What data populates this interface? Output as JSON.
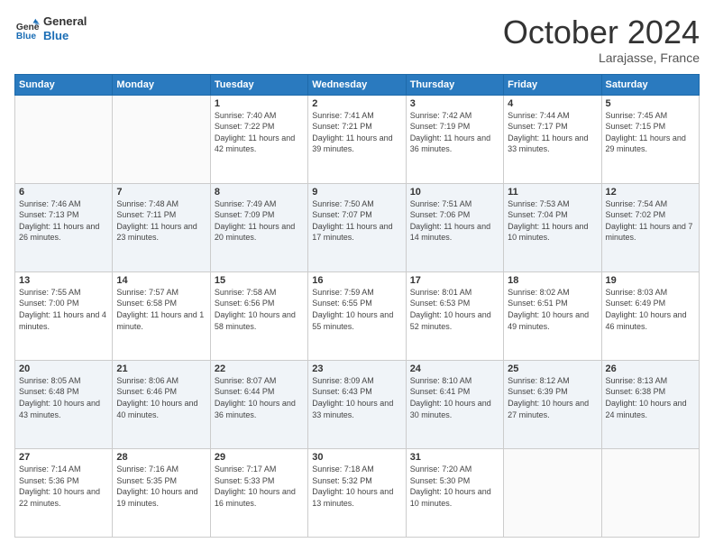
{
  "header": {
    "logo_line1": "General",
    "logo_line2": "Blue",
    "month": "October 2024",
    "location": "Larajasse, France"
  },
  "weekdays": [
    "Sunday",
    "Monday",
    "Tuesday",
    "Wednesday",
    "Thursday",
    "Friday",
    "Saturday"
  ],
  "weeks": [
    [
      {
        "day": "",
        "info": ""
      },
      {
        "day": "",
        "info": ""
      },
      {
        "day": "1",
        "info": "Sunrise: 7:40 AM\nSunset: 7:22 PM\nDaylight: 11 hours and 42 minutes."
      },
      {
        "day": "2",
        "info": "Sunrise: 7:41 AM\nSunset: 7:21 PM\nDaylight: 11 hours and 39 minutes."
      },
      {
        "day": "3",
        "info": "Sunrise: 7:42 AM\nSunset: 7:19 PM\nDaylight: 11 hours and 36 minutes."
      },
      {
        "day": "4",
        "info": "Sunrise: 7:44 AM\nSunset: 7:17 PM\nDaylight: 11 hours and 33 minutes."
      },
      {
        "day": "5",
        "info": "Sunrise: 7:45 AM\nSunset: 7:15 PM\nDaylight: 11 hours and 29 minutes."
      }
    ],
    [
      {
        "day": "6",
        "info": "Sunrise: 7:46 AM\nSunset: 7:13 PM\nDaylight: 11 hours and 26 minutes."
      },
      {
        "day": "7",
        "info": "Sunrise: 7:48 AM\nSunset: 7:11 PM\nDaylight: 11 hours and 23 minutes."
      },
      {
        "day": "8",
        "info": "Sunrise: 7:49 AM\nSunset: 7:09 PM\nDaylight: 11 hours and 20 minutes."
      },
      {
        "day": "9",
        "info": "Sunrise: 7:50 AM\nSunset: 7:07 PM\nDaylight: 11 hours and 17 minutes."
      },
      {
        "day": "10",
        "info": "Sunrise: 7:51 AM\nSunset: 7:06 PM\nDaylight: 11 hours and 14 minutes."
      },
      {
        "day": "11",
        "info": "Sunrise: 7:53 AM\nSunset: 7:04 PM\nDaylight: 11 hours and 10 minutes."
      },
      {
        "day": "12",
        "info": "Sunrise: 7:54 AM\nSunset: 7:02 PM\nDaylight: 11 hours and 7 minutes."
      }
    ],
    [
      {
        "day": "13",
        "info": "Sunrise: 7:55 AM\nSunset: 7:00 PM\nDaylight: 11 hours and 4 minutes."
      },
      {
        "day": "14",
        "info": "Sunrise: 7:57 AM\nSunset: 6:58 PM\nDaylight: 11 hours and 1 minute."
      },
      {
        "day": "15",
        "info": "Sunrise: 7:58 AM\nSunset: 6:56 PM\nDaylight: 10 hours and 58 minutes."
      },
      {
        "day": "16",
        "info": "Sunrise: 7:59 AM\nSunset: 6:55 PM\nDaylight: 10 hours and 55 minutes."
      },
      {
        "day": "17",
        "info": "Sunrise: 8:01 AM\nSunset: 6:53 PM\nDaylight: 10 hours and 52 minutes."
      },
      {
        "day": "18",
        "info": "Sunrise: 8:02 AM\nSunset: 6:51 PM\nDaylight: 10 hours and 49 minutes."
      },
      {
        "day": "19",
        "info": "Sunrise: 8:03 AM\nSunset: 6:49 PM\nDaylight: 10 hours and 46 minutes."
      }
    ],
    [
      {
        "day": "20",
        "info": "Sunrise: 8:05 AM\nSunset: 6:48 PM\nDaylight: 10 hours and 43 minutes."
      },
      {
        "day": "21",
        "info": "Sunrise: 8:06 AM\nSunset: 6:46 PM\nDaylight: 10 hours and 40 minutes."
      },
      {
        "day": "22",
        "info": "Sunrise: 8:07 AM\nSunset: 6:44 PM\nDaylight: 10 hours and 36 minutes."
      },
      {
        "day": "23",
        "info": "Sunrise: 8:09 AM\nSunset: 6:43 PM\nDaylight: 10 hours and 33 minutes."
      },
      {
        "day": "24",
        "info": "Sunrise: 8:10 AM\nSunset: 6:41 PM\nDaylight: 10 hours and 30 minutes."
      },
      {
        "day": "25",
        "info": "Sunrise: 8:12 AM\nSunset: 6:39 PM\nDaylight: 10 hours and 27 minutes."
      },
      {
        "day": "26",
        "info": "Sunrise: 8:13 AM\nSunset: 6:38 PM\nDaylight: 10 hours and 24 minutes."
      }
    ],
    [
      {
        "day": "27",
        "info": "Sunrise: 7:14 AM\nSunset: 5:36 PM\nDaylight: 10 hours and 22 minutes."
      },
      {
        "day": "28",
        "info": "Sunrise: 7:16 AM\nSunset: 5:35 PM\nDaylight: 10 hours and 19 minutes."
      },
      {
        "day": "29",
        "info": "Sunrise: 7:17 AM\nSunset: 5:33 PM\nDaylight: 10 hours and 16 minutes."
      },
      {
        "day": "30",
        "info": "Sunrise: 7:18 AM\nSunset: 5:32 PM\nDaylight: 10 hours and 13 minutes."
      },
      {
        "day": "31",
        "info": "Sunrise: 7:20 AM\nSunset: 5:30 PM\nDaylight: 10 hours and 10 minutes."
      },
      {
        "day": "",
        "info": ""
      },
      {
        "day": "",
        "info": ""
      }
    ]
  ]
}
